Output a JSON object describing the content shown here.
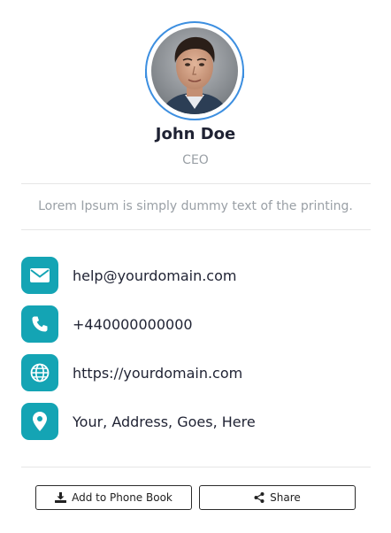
{
  "profile": {
    "name": "John Doe",
    "role": "CEO",
    "bio": "Lorem Ipsum is simply dummy text of the printing."
  },
  "contacts": [
    {
      "icon": "email-icon",
      "label": "help@yourdomain.com"
    },
    {
      "icon": "phone-icon",
      "label": "+440000000000"
    },
    {
      "icon": "globe-icon",
      "label": "https://yourdomain.com"
    },
    {
      "icon": "location-pin-icon",
      "label": "Your, Address, Goes, Here"
    }
  ],
  "actions": {
    "add_to_phone_book": "Add to Phone Book",
    "share": "Share"
  },
  "colors": {
    "accent": "#14a4b4",
    "avatar_ring": "#3d8fe0",
    "text_dark": "#1f2233",
    "text_muted": "#9aa0a6"
  }
}
